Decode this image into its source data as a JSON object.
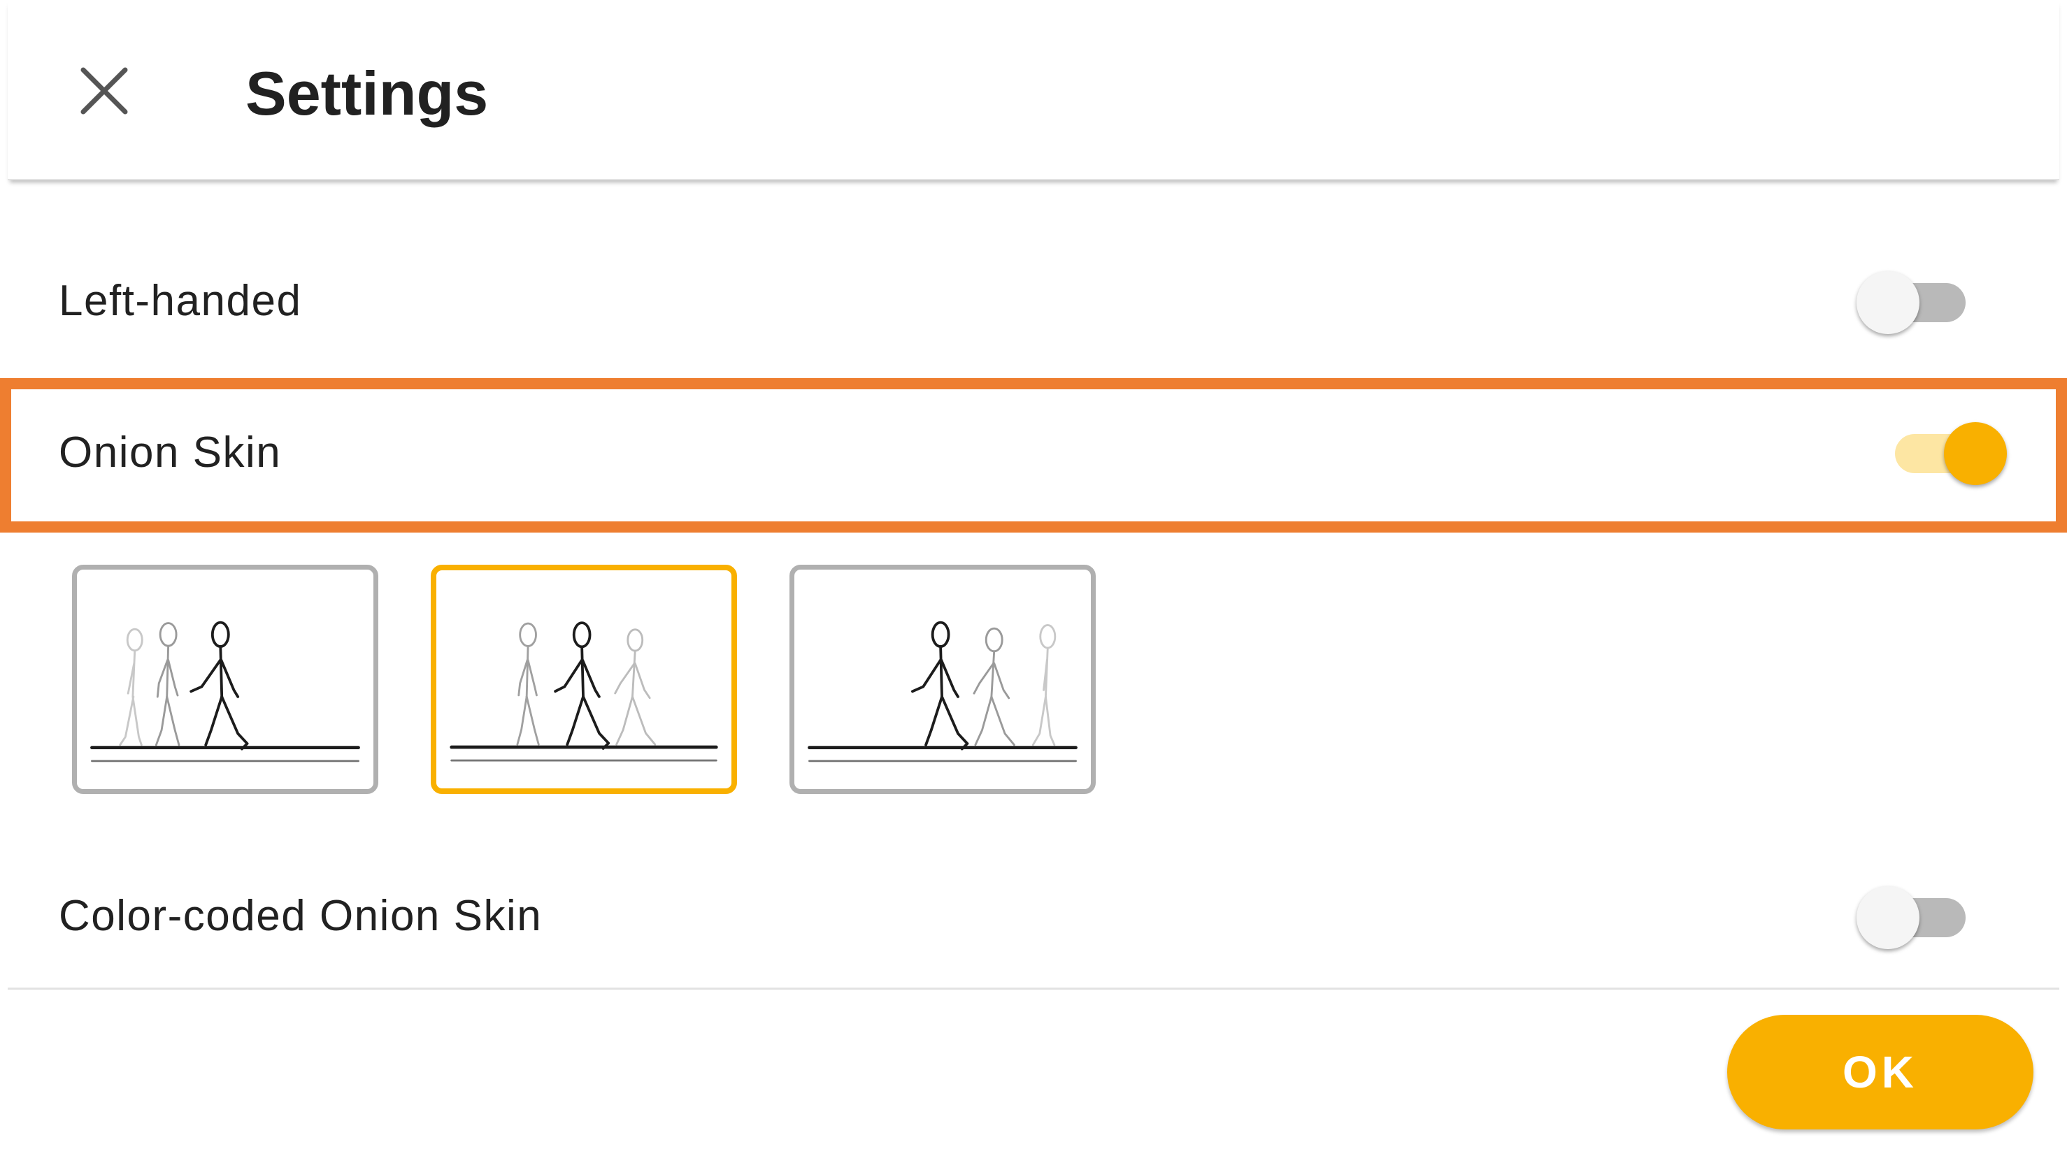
{
  "header": {
    "title": "Settings",
    "close_icon": "close-icon"
  },
  "settings": [
    {
      "label": "Left-handed",
      "enabled": false
    },
    {
      "label": "Onion Skin",
      "enabled": true
    },
    {
      "label": "Color-coded Onion Skin",
      "enabled": false
    }
  ],
  "onion_skin_modes": [
    {
      "name": "previous-frames",
      "selected": false
    },
    {
      "name": "previous-and-next-frames",
      "selected": true
    },
    {
      "name": "next-frames",
      "selected": false
    }
  ],
  "footer": {
    "ok_label": "OK"
  },
  "colors": {
    "accent": "#f9b000",
    "accent_light": "#fde6a3",
    "highlight": "#ee7e30",
    "switch_off_track": "#b9b9b9"
  }
}
